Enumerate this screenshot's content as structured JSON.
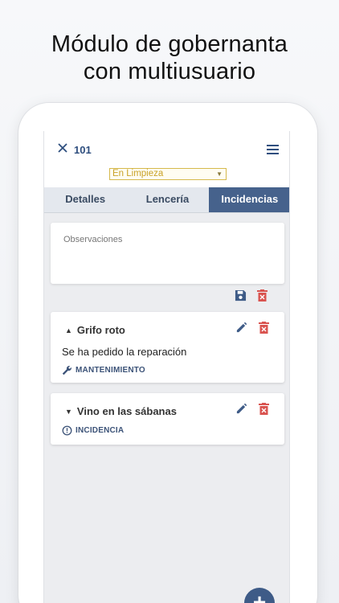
{
  "headline": {
    "line1": "Módulo de gobernanta",
    "line2": "con multiusuario"
  },
  "header": {
    "room": "101",
    "close_icon": "close-icon",
    "menu_icon": "menu-icon"
  },
  "status": {
    "value": "En Limpieza",
    "color": "#c9a227"
  },
  "tabs": [
    {
      "label": "Detalles",
      "active": false
    },
    {
      "label": "Lencería",
      "active": false
    },
    {
      "label": "Incidencias",
      "active": true
    }
  ],
  "observations": {
    "placeholder": "Observaciones"
  },
  "incidents": [
    {
      "title": "Grifo roto",
      "description": "Se ha pedido la reparación",
      "tag": "MANTENIMIENTO",
      "tag_icon": "wrench-icon",
      "expanded": true
    },
    {
      "title": "Vino en las sábanas",
      "tag": "INCIDENCIA",
      "tag_icon": "alert-circle-icon",
      "expanded": false
    }
  ],
  "colors": {
    "accent": "#46628c",
    "danger": "#d9534f",
    "status": "#c9a227"
  },
  "fab": {
    "icon": "add-icon",
    "label": "+"
  }
}
